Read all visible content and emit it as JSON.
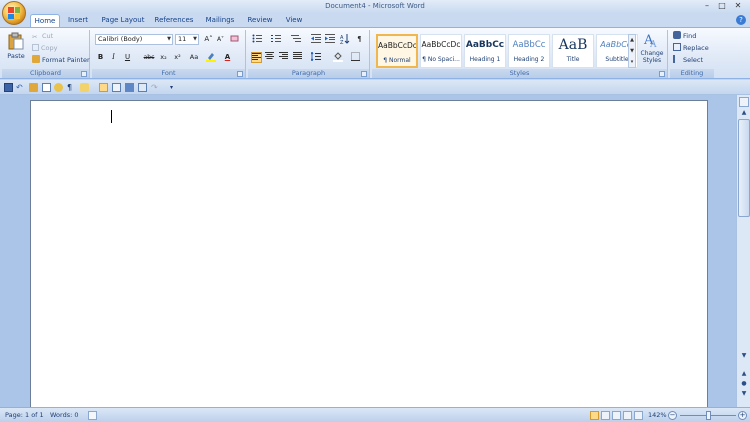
{
  "window": {
    "title": "Document4 - Microsoft Word",
    "minimize_glyph": "–",
    "maximize_glyph": "□",
    "close_glyph": "✕"
  },
  "tabs": [
    "Home",
    "Insert",
    "Page Layout",
    "References",
    "Mailings",
    "Review",
    "View"
  ],
  "help_glyph": "?",
  "clipboard": {
    "paste": "Paste",
    "cut": "Cut",
    "copy": "Copy",
    "format_painter": "Format Painter",
    "label": "Clipboard"
  },
  "font": {
    "name": "Calibri (Body)",
    "size": "11",
    "grow": "A˄",
    "shrink": "A˅",
    "bold": "B",
    "italic": "I",
    "underline": "U",
    "strike": "abc",
    "subscript": "x₂",
    "superscript": "x²",
    "change_case": "Aa",
    "font_color": "A",
    "label": "Font"
  },
  "paragraph": {
    "show_marks": "¶",
    "label": "Paragraph"
  },
  "styles": {
    "items": [
      {
        "sample": "AaBbCcDc",
        "name": "¶ Normal"
      },
      {
        "sample": "AaBbCcDc",
        "name": "¶ No Spaci..."
      },
      {
        "sample": "AaBbCc",
        "name": "Heading 1"
      },
      {
        "sample": "AaBbCc",
        "name": "Heading 2"
      },
      {
        "sample": "AaB",
        "name": "Title"
      },
      {
        "sample": "AaBbCc.",
        "name": "Subtitle"
      }
    ],
    "change_styles": "Change Styles",
    "label": "Styles"
  },
  "editing": {
    "find": "Find",
    "replace": "Replace",
    "select": "Select",
    "label": "Editing"
  },
  "status": {
    "page": "Page: 1 of 1",
    "words": "Words: 0",
    "zoom": "142%",
    "zoom_minus": "−",
    "zoom_plus": "+"
  },
  "colors": {
    "ribbon_bg": "#dfe9f5",
    "accent": "#15428b",
    "selected_style": "#f0b64f",
    "page_bg": "#ffffff",
    "workspace": "#abc5e8"
  }
}
